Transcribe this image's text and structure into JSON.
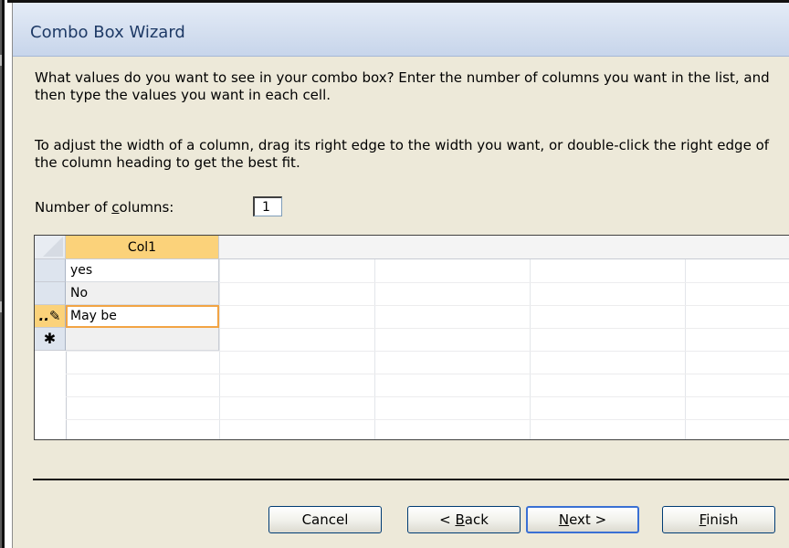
{
  "dialog": {
    "title": "Combo Box Wizard",
    "instruction_1": "What values do you want to see in your combo box? Enter the number of columns you want in the list, and then type the values you want in each cell.",
    "instruction_2": "To adjust the width of a column, drag its right edge to the width you want, or double-click the right edge of the column heading to get the best fit.",
    "num_columns_label": "Number of columns:",
    "num_columns_label_access_key": "c",
    "num_columns_value": "1"
  },
  "grid": {
    "column_header": "Col1",
    "rows": [
      {
        "value": "yes",
        "selector": ""
      },
      {
        "value": "No",
        "selector": ""
      },
      {
        "value": "May be",
        "selector": "pencil-icon",
        "selector_glyph": "..✎"
      },
      {
        "value": "",
        "selector": "new-record-icon",
        "selector_glyph": "✱"
      }
    ],
    "active_row_index": 2
  },
  "buttons": {
    "cancel": "Cancel",
    "back": "< Back",
    "back_access_key": "B",
    "next": "Next >",
    "next_access_key": "N",
    "finish": "Finish",
    "finish_access_key": "F"
  },
  "colors": {
    "dialog_bg": "#ede9d9",
    "header_highlight": "#fbd27a",
    "active_cell_border": "#f2a444",
    "title_text": "#1e3a66"
  }
}
